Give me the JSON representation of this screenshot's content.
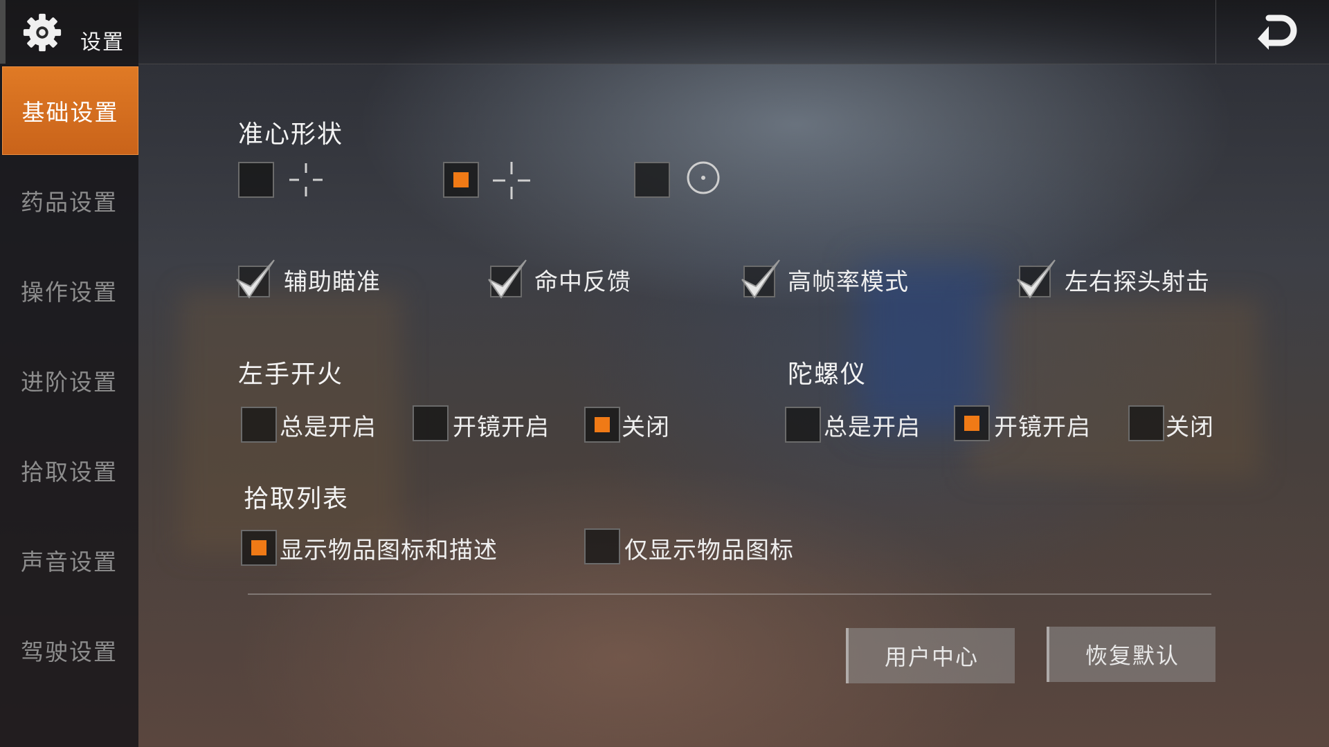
{
  "header": {
    "title": "设置",
    "icon": "gear-icon",
    "back_icon": "back-arrow-icon"
  },
  "accent_color": "#e07a25",
  "sidebar": {
    "items": [
      {
        "label": "基础设置",
        "active": true
      },
      {
        "label": "药品设置",
        "active": false
      },
      {
        "label": "操作设置",
        "active": false
      },
      {
        "label": "进阶设置",
        "active": false
      },
      {
        "label": "拾取设置",
        "active": false
      },
      {
        "label": "声音设置",
        "active": false
      },
      {
        "label": "驾驶设置",
        "active": false
      }
    ]
  },
  "crosshair": {
    "title": "准心形状",
    "options": [
      {
        "icon": "crosshair-small-icon",
        "selected": false
      },
      {
        "icon": "crosshair-large-icon",
        "selected": true
      },
      {
        "icon": "crosshair-circle-dot-icon",
        "selected": false
      }
    ]
  },
  "toggles": [
    {
      "label": "辅助瞄准",
      "checked": true
    },
    {
      "label": "命中反馈",
      "checked": true
    },
    {
      "label": "高帧率模式",
      "checked": true
    },
    {
      "label": "左右探头射击",
      "checked": true
    }
  ],
  "left_fire": {
    "title": "左手开火",
    "options": [
      {
        "label": "总是开启",
        "selected": false
      },
      {
        "label": "开镜开启",
        "selected": false
      },
      {
        "label": "关闭",
        "selected": true
      }
    ]
  },
  "gyroscope": {
    "title": "陀螺仪",
    "options": [
      {
        "label": "总是开启",
        "selected": false
      },
      {
        "label": "开镜开启",
        "selected": true
      },
      {
        "label": "关闭",
        "selected": false
      }
    ]
  },
  "pickup_list": {
    "title": "拾取列表",
    "options": [
      {
        "label": "显示物品图标和描述",
        "selected": true
      },
      {
        "label": "仅显示物品图标",
        "selected": false
      }
    ]
  },
  "actions": {
    "user_center": "用户中心",
    "restore_default": "恢复默认"
  }
}
